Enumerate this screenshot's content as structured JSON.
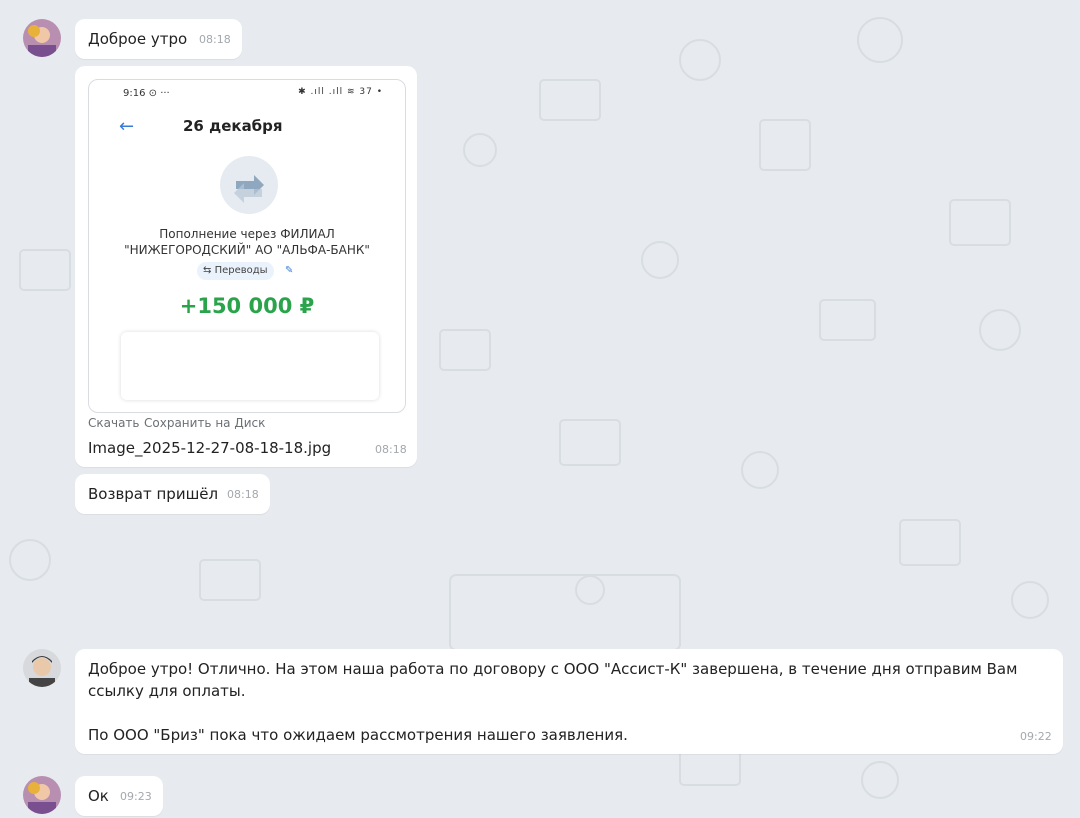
{
  "messages": {
    "m1": {
      "text": "Доброе утро",
      "time": "08:18"
    },
    "m2": {
      "screenshot": {
        "status_time": "9:16 ⊙ ···",
        "status_right": "✱ .ıll .ıll ≋ 37 •",
        "title": "26 декабря",
        "desc_line1": "Пополнение через ФИЛИАЛ",
        "desc_line2": "\"НИЖЕГОРОДСКИЙ\" АО \"АЛЬФА-БАНК\"",
        "tag": "Переводы",
        "amount": "+150 000 ₽"
      },
      "download_label": "Скачать",
      "save_label": "Сохранить на Диск",
      "filename": "Image_2025-12-27-08-18-18.jpg",
      "time": "08:18"
    },
    "m3": {
      "text": "Возврат пришёл",
      "time": "08:18"
    },
    "m4": {
      "line1": "Доброе утро! Отлично. На этом наша работа по договору с ООО \"Ассист-К\" завершена, в течение дня отправим Вам",
      "line2": "ссылку для оплаты.",
      "line3": "По ООО \"Бриз\" пока что ожидаем рассмотрения нашего заявления.",
      "time": "09:22"
    },
    "m5": {
      "text": "Ок",
      "time": "09:23"
    }
  },
  "colors": {
    "background": "#e7ebef",
    "bubble": "#ffffff",
    "amount": "#2aa34a",
    "accent": "#3a7bd5"
  }
}
